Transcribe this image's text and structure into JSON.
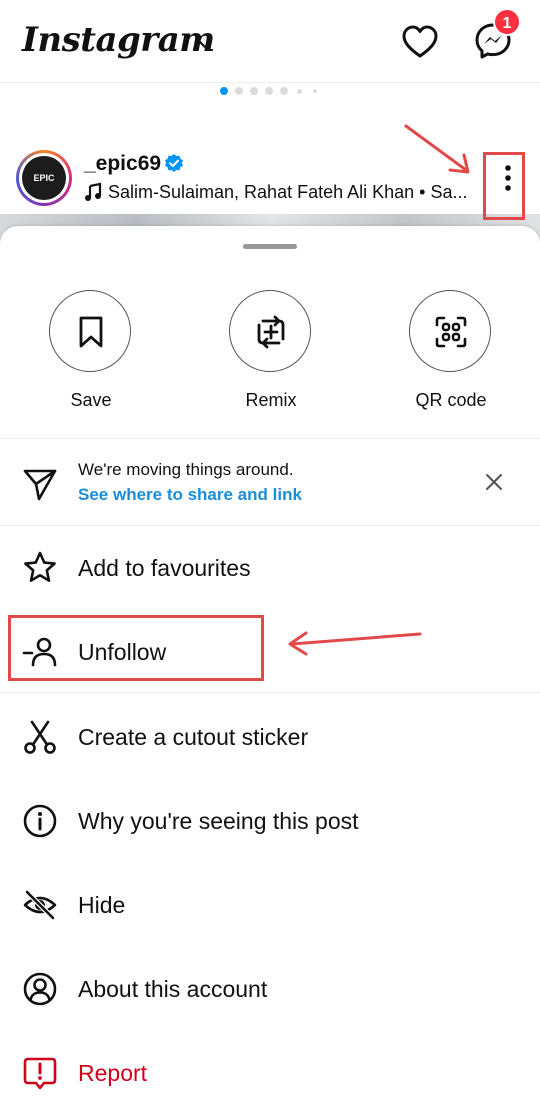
{
  "header": {
    "logo": "Instagram",
    "notification_count": "1"
  },
  "post": {
    "username": "_epic69",
    "avatar_text": "EPIC",
    "song": "Salim-Sulaiman, Rahat Fateh Ali Khan • Sa..."
  },
  "sheet": {
    "actions": [
      {
        "label": "Save",
        "icon": "bookmark-icon"
      },
      {
        "label": "Remix",
        "icon": "remix-icon"
      },
      {
        "label": "QR code",
        "icon": "qr-code-icon"
      }
    ],
    "notice": {
      "text": "We're moving things around.",
      "link": "See where to share and link"
    },
    "menu": [
      {
        "label": "Add to favourites",
        "icon": "star-icon"
      },
      {
        "label": "Unfollow",
        "icon": "unfollow-icon"
      },
      {
        "label": "Create a cutout sticker",
        "icon": "scissors-icon"
      },
      {
        "label": "Why you're seeing this post",
        "icon": "info-icon"
      },
      {
        "label": "Hide",
        "icon": "eye-off-icon"
      },
      {
        "label": "About this account",
        "icon": "account-icon"
      },
      {
        "label": "Report",
        "icon": "report-icon",
        "color": "#d0021b"
      }
    ]
  },
  "colors": {
    "accent": "#0095f6",
    "link": "#1a8fd8",
    "danger": "#d0021b",
    "annotation": "#e04a4a"
  }
}
